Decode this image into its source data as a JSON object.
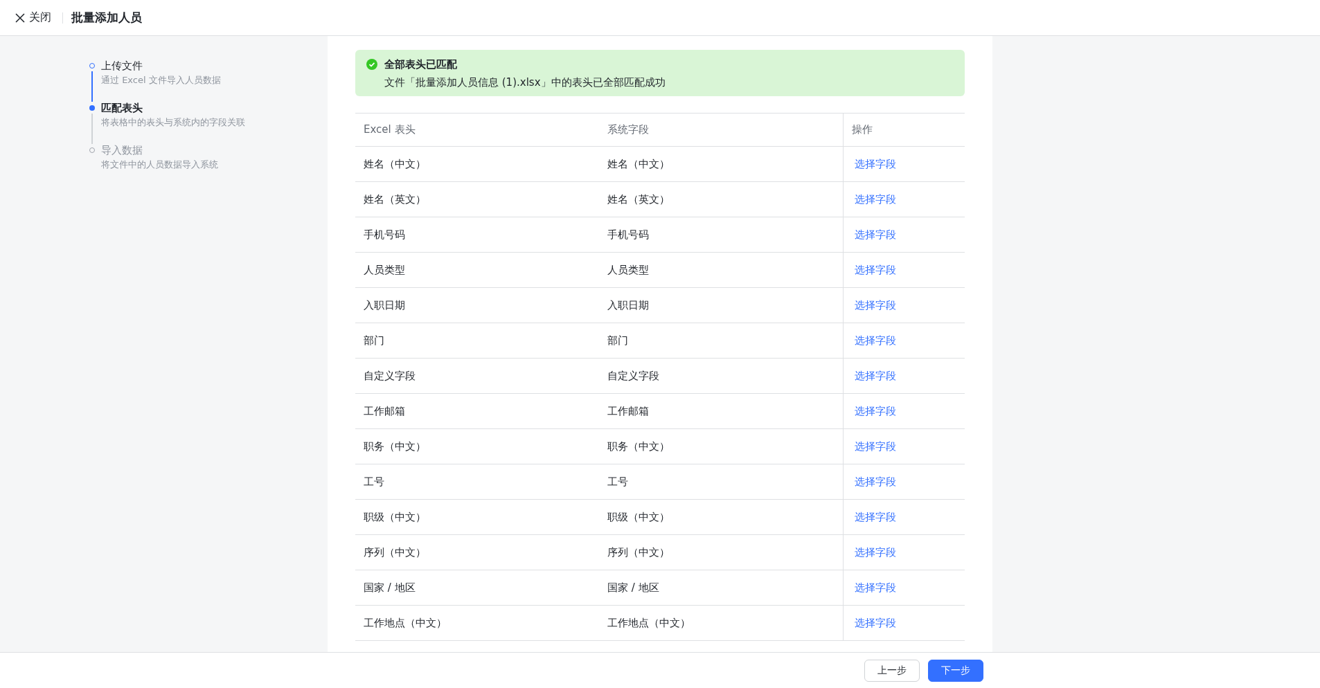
{
  "header": {
    "close_label": "关闭",
    "title": "批量添加人员"
  },
  "steps": [
    {
      "title": "上传文件",
      "description": "通过 Excel 文件导入人员数据",
      "completed": true,
      "selected": false
    },
    {
      "title": "匹配表头",
      "description": "将表格中的表头与系统内的字段关联",
      "completed": false,
      "selected": true
    },
    {
      "title": "导入数据",
      "description": "将文件中的人员数据导入系统",
      "completed": false,
      "selected": false
    }
  ],
  "alert": {
    "kind": "success",
    "title": "全部表头已匹配",
    "message": "文件「批量添加人员信息 (1).xlsx」中的表头已全部匹配成功"
  },
  "table": {
    "columns": [
      "Excel 表头",
      "系统字段",
      "操作"
    ],
    "rows": [
      {
        "excel": "姓名（中文）",
        "field": "姓名（中文）",
        "action": "选择字段"
      },
      {
        "excel": "姓名（英文）",
        "field": "姓名（英文）",
        "action": "选择字段"
      },
      {
        "excel": "手机号码",
        "field": "手机号码",
        "action": "选择字段"
      },
      {
        "excel": "人员类型",
        "field": "人员类型",
        "action": "选择字段"
      },
      {
        "excel": "入职日期",
        "field": "入职日期",
        "action": "选择字段"
      },
      {
        "excel": "部门",
        "field": "部门",
        "action": "选择字段"
      },
      {
        "excel": "自定义字段",
        "field": "自定义字段",
        "action": "选择字段"
      },
      {
        "excel": "工作邮箱",
        "field": "工作邮箱",
        "action": "选择字段"
      },
      {
        "excel": "职务（中文）",
        "field": "职务（中文）",
        "action": "选择字段"
      },
      {
        "excel": "工号",
        "field": "工号",
        "action": "选择字段"
      },
      {
        "excel": "职级（中文）",
        "field": "职级（中文）",
        "action": "选择字段"
      },
      {
        "excel": "序列（中文）",
        "field": "序列（中文）",
        "action": "选择字段"
      },
      {
        "excel": "国家 / 地区",
        "field": "国家 / 地区",
        "action": "选择字段"
      },
      {
        "excel": "工作地点（中文）",
        "field": "工作地点（中文）",
        "action": "选择字段"
      }
    ]
  },
  "footer": {
    "prev": "上一步",
    "next": "下一步"
  }
}
